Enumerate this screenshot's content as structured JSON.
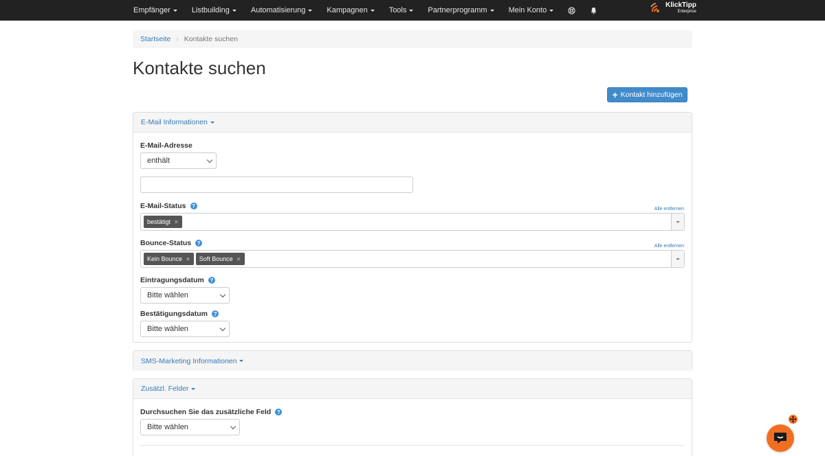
{
  "nav": {
    "items": [
      {
        "label": "Empfänger"
      },
      {
        "label": "Listbuilding"
      },
      {
        "label": "Automatisierung"
      },
      {
        "label": "Kampagnen"
      },
      {
        "label": "Tools"
      },
      {
        "label": "Partnerprogramm"
      },
      {
        "label": "Mein Konto"
      }
    ],
    "icons": [
      "help-circle-icon",
      "bell-icon"
    ],
    "brand": {
      "name": "KlickTipp",
      "sub": "Enterprise"
    }
  },
  "breadcrumb": {
    "home": "Startseite",
    "current": "Kontakte suchen"
  },
  "page": {
    "title": "Kontakte suchen",
    "add_button": "Kontakt hinzufügen"
  },
  "email_panel": {
    "heading": "E-Mail Informationen",
    "address_label": "E-Mail-Adresse",
    "operator_value": "enthält",
    "address_value": "",
    "status_label": "E-Mail-Status",
    "status_remove_all": "Alle entfernen",
    "status_tags": [
      "bestätigt"
    ],
    "bounce_label": "Bounce-Status",
    "bounce_remove_all": "Alle entfernen",
    "bounce_tags": [
      "Kein Bounce",
      "Soft Bounce"
    ],
    "signup_date_label": "Eintragungsdatum",
    "signup_date_value": "Bitte wählen",
    "confirm_date_label": "Bestätigungsdatum",
    "confirm_date_value": "Bitte wählen"
  },
  "sms_panel": {
    "heading": "SMS-Marketing Informationen"
  },
  "fields_panel": {
    "heading": "Zusätzl. Felder",
    "search_label": "Durchsuchen Sie das zusätzliche Feld",
    "search_value": "Bitte wählen"
  },
  "colors": {
    "primary": "#428bca",
    "navbar": "#222222",
    "chat": "#f26f22",
    "tag": "#555555"
  }
}
